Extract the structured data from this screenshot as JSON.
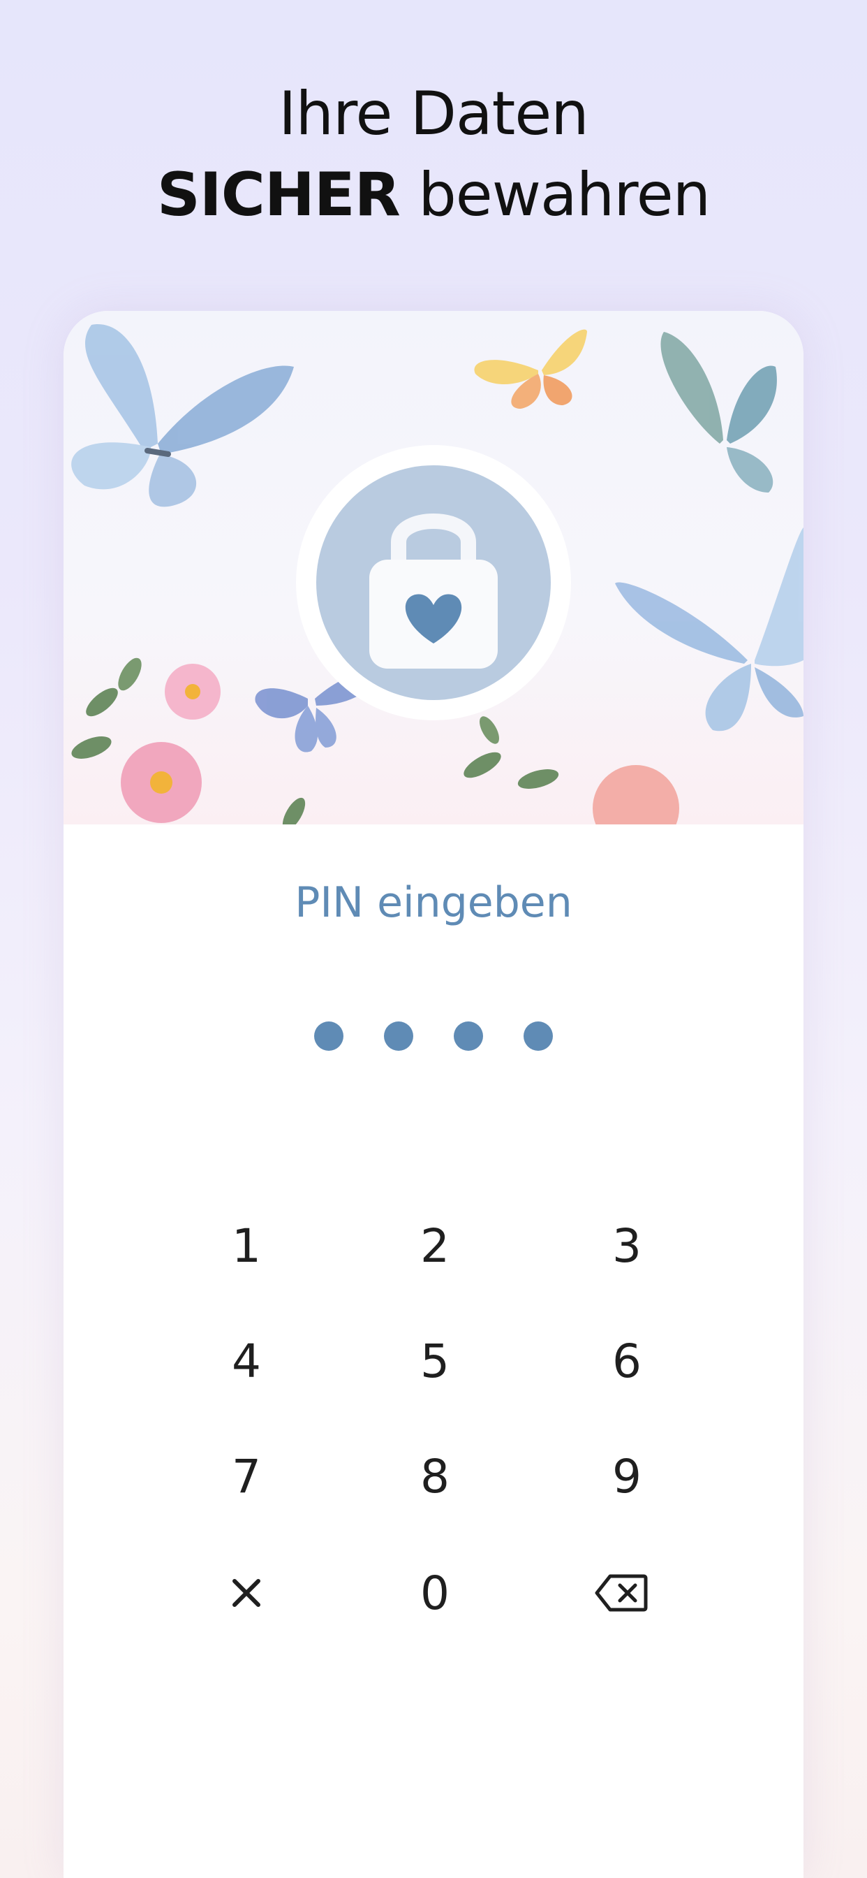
{
  "headline": {
    "line1": "Ihre Daten",
    "line2_bold": "SICHER",
    "line2_rest": " bewahren"
  },
  "pin": {
    "title": "PIN eingeben",
    "entered_digits": 4
  },
  "keypad": {
    "keys": [
      "1",
      "2",
      "3",
      "4",
      "5",
      "6",
      "7",
      "8",
      "9",
      "0"
    ],
    "cancel_icon": "close-icon",
    "delete_icon": "backspace-icon"
  },
  "colors": {
    "accent": "#5f8bb5",
    "lock_circle": "#b9cbe0",
    "text": "#1f1f1f"
  },
  "icons": {
    "lock": "padlock-heart-icon"
  }
}
